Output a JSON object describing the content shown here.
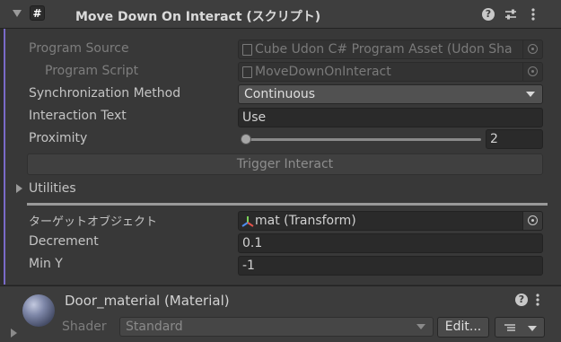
{
  "component": {
    "title": "Move Down On Interact (スクリプト)",
    "icon": "udon-script-icon"
  },
  "fields": {
    "program_source": {
      "label": "Program Source",
      "value": "Cube Udon C# Program Asset (Udon Sha"
    },
    "program_script": {
      "label": "Program Script",
      "value": "MoveDownOnInteract"
    },
    "sync_method": {
      "label": "Synchronization Method",
      "value": "Continuous"
    },
    "interaction_text": {
      "label": "Interaction Text",
      "value": "Use"
    },
    "proximity": {
      "label": "Proximity",
      "value": "2",
      "slider_fraction": 0.0
    },
    "trigger_button": "Trigger Interact",
    "utilities": "Utilities",
    "target_object": {
      "label": "ターゲットオブジェクト",
      "value": "mat (Transform)"
    },
    "decrement": {
      "label": "Decrement",
      "value": "0.1"
    },
    "min_y": {
      "label": "Min Y",
      "value": "-1"
    }
  },
  "material": {
    "name": "Door_material (Material)",
    "shader_label": "Shader",
    "shader_value": "Standard",
    "edit_button": "Edit..."
  },
  "colors": {
    "accent": "#7a6bc8",
    "header": "#3e3e3e",
    "panel": "#383838"
  }
}
